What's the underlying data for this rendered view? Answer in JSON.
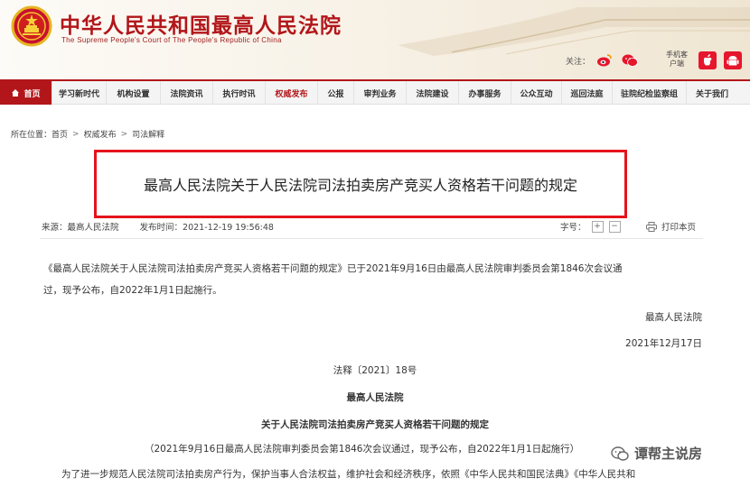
{
  "header": {
    "site_title": "中华人民共和国最高人民法院",
    "site_subtitle": "The Supreme People's Court of The People's Republic of China",
    "follow_label": "关注：",
    "social_icons": [
      "weibo-icon",
      "wechat-icon"
    ],
    "mobile_client_label": "手机客户端",
    "platform_icons": [
      "apple-icon",
      "android-icon"
    ]
  },
  "nav": {
    "items": [
      {
        "label": "首页"
      },
      {
        "label": "学习新时代"
      },
      {
        "label": "机构设置"
      },
      {
        "label": "法院资讯"
      },
      {
        "label": "执行时讯"
      },
      {
        "label": "权威发布"
      },
      {
        "label": "公报"
      },
      {
        "label": "审判业务"
      },
      {
        "label": "法院建设"
      },
      {
        "label": "办事服务"
      },
      {
        "label": "公众互动"
      },
      {
        "label": "巡回法庭"
      },
      {
        "label": "驻院纪检监察组"
      },
      {
        "label": "关于我们"
      }
    ],
    "active_index": 5
  },
  "breadcrumb": {
    "prefix": "所在位置：",
    "items": [
      "首页",
      "权威发布",
      "司法解释"
    ],
    "separator": ">"
  },
  "article": {
    "title": "最高人民法院关于人民法院司法拍卖房产竞买人资格若干问题的规定",
    "source": "来源：最高人民法院",
    "publish_time": "发布时间：2021-12-19 19:56:48",
    "font_size_label": "字号：",
    "font_increase": "+",
    "font_decrease": "−",
    "print_label": "打印本页",
    "intro_line1": "《最高人民法院关于人民法院司法拍卖房产竞买人资格若干问题的规定》已于2021年9月16日由最高人民法院审判委员会第1846次会议通",
    "intro_line2": "过，现予公布，自2022年1月1日起施行。",
    "signer": "最高人民法院",
    "sign_date": "2021年12月17日",
    "doc_number": "法释〔2021〕18号",
    "issuer": "最高人民法院",
    "doc_title": "关于人民法院司法拍卖房产竞买人资格若干问题的规定",
    "adoption_note": "（2021年9月16日最高人民法院审判委员会第1846次会议通过，现予公布，自2022年1月1日起施行）",
    "body_start": "为了进一步规范人民法院司法拍卖房产行为，保护当事人合法权益，维护社会和经济秩序，依照《中华人民共和国民法典》《中华人民共和"
  },
  "watermark": {
    "icon": "wechat-icon",
    "text": "谭帮主说房"
  },
  "colors": {
    "brand_red": "#b2161a",
    "highlight_box": "#e5141c"
  }
}
